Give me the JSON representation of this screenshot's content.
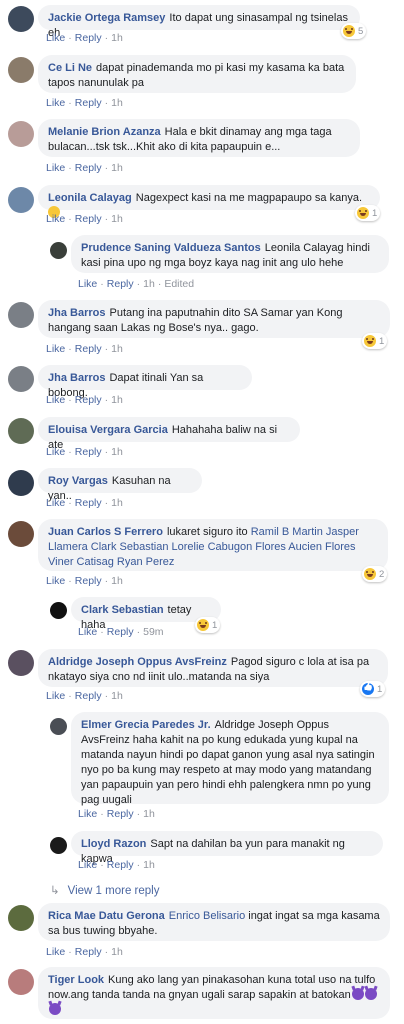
{
  "actions": {
    "like": "Like",
    "reply": "Reply",
    "edited": "Edited"
  },
  "comments": [
    {
      "name": "Jackie Ortega Ramsey",
      "text": "Ito dapat ung sinasampal ng tsinelas eh",
      "time": "1h",
      "react": "5"
    },
    {
      "name": "Ce Li Ne",
      "text": "dapat pinademanda mo pi kasi my kasama ka bata tapos nanunulak pa",
      "time": "1h"
    },
    {
      "name": "Melanie Brion Azanza",
      "text": "Hala e bkit dinamay ang mga taga bulacan...tsk tsk...Khit ako di kita papaupuin e...",
      "time": "1h"
    },
    {
      "name": "Leonila Calayag",
      "text": "Nagexpect kasi na me magpapaupo sa kanya.",
      "time": "1h",
      "react": "1"
    },
    {
      "name": "Prudence Saning Valdueza Santos",
      "text": "Leonila Calayag hindi kasi pina upo ng mga boyz kaya nag init ang ulo hehe",
      "time": "1h"
    },
    {
      "name": "Jha Barros",
      "text": "Putang ina paputnahin dito SA Samar yan Kong hangang saan Lakas ng Bose's nya.. gago.",
      "time": "1h",
      "react": "1"
    },
    {
      "name": "Jha Barros",
      "text": "Dapat itinali Yan sa bobong.",
      "time": "1h"
    },
    {
      "name": "Elouisa Vergara Garcia",
      "text": "Hahahaha baliw na si ate",
      "time": "1h"
    },
    {
      "name": "Roy Vargas",
      "text": "Kasuhan na yan..",
      "time": "1h"
    },
    {
      "name": "Juan Carlos S Ferrero",
      "text": "lukaret siguro ito",
      "mentions": "Ramil B Martin Jasper Llamera Clark Sebastian Lorelie Cabugon Flores Aucien Flores Viner Catisag Ryan Perez",
      "time": "1h",
      "react": "2"
    },
    {
      "name": "Clark Sebastian",
      "text": "tetay haha",
      "time": "59m",
      "react": "1"
    },
    {
      "name": "Aldridge Joseph Oppus AvsFreinz",
      "text": "Pagod siguro c lola at isa pa nkatayo siya cno nd iinit ulo..matanda na siya",
      "time": "1h",
      "react": "1"
    },
    {
      "name": "Elmer Grecia Paredes Jr.",
      "text": "Aldridge Joseph Oppus AvsFreinz haha kahit na po kung edukada yung kupal na matanda nayun hindi po dapat ganon yung asal nya satingin nyo po ba kung may respeto at may modo yang matandang yan papaupuin yan pero hindi ehh palengkera nmn po yung pag uugali",
      "time": "1h"
    },
    {
      "name": "Lloyd Razon",
      "text": "Sapt na dahilan ba yun para manakit ng kapwa",
      "time": "1h"
    },
    {
      "name": "Rica Mae Datu Gerona",
      "mention": "Enrico Belisario",
      "text": "ingat ingat sa mga kasama sa bus tuwing bbyahe.",
      "time": "1h"
    },
    {
      "name": "Tiger Look",
      "text": "Kung ako lang yan pinakasohan kuna total uso na tulfo now.ang tanda tanda na gnyan ugali sarap sapakin at batokan"
    }
  ],
  "view_more": "View 1 more reply"
}
